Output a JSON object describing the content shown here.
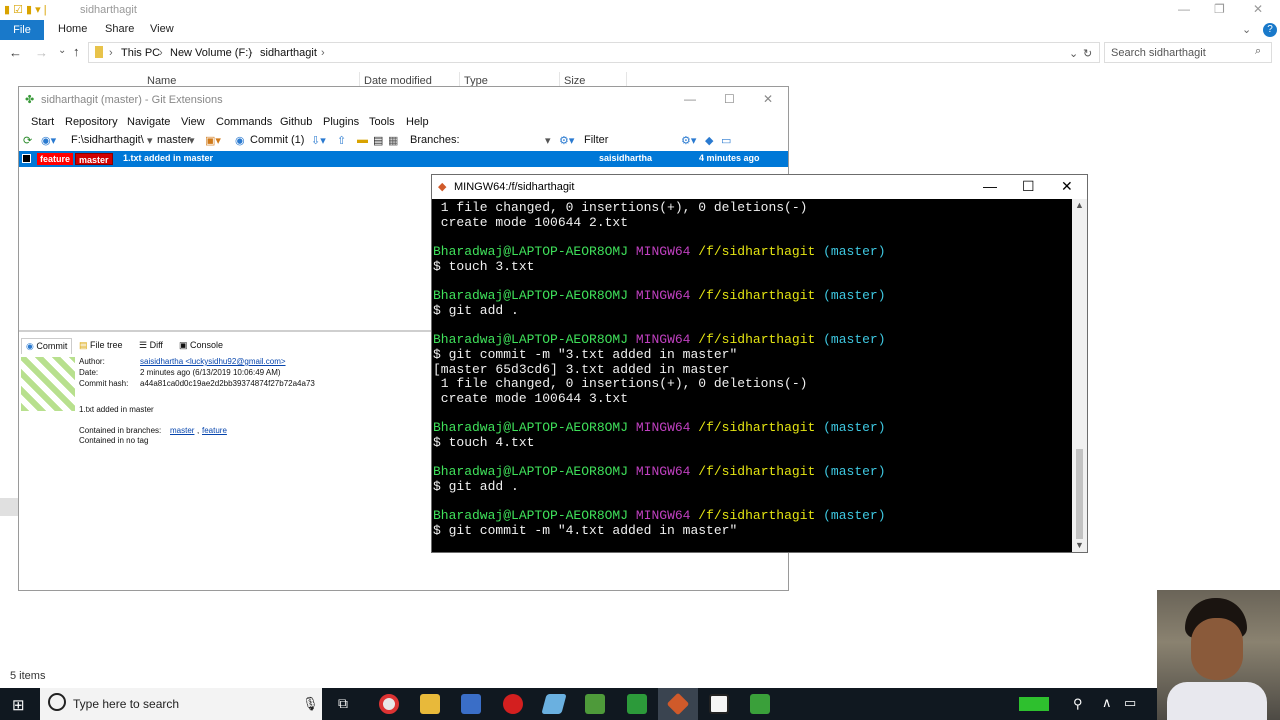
{
  "explorer": {
    "title": "sidharthagit",
    "ribbon": {
      "file": "File",
      "tabs": [
        "Home",
        "Share",
        "View"
      ]
    },
    "address": {
      "crumbs": [
        "This PC",
        "New Volume (F:)",
        "sidharthagit"
      ]
    },
    "search_placeholder": "Search sidharthagit",
    "columns": [
      "Name",
      "Date modified",
      "Type",
      "Size"
    ],
    "status": "5 items"
  },
  "gitext": {
    "title": "sidharthagit (master) - Git Extensions",
    "menu": [
      "Start",
      "Repository",
      "Navigate",
      "View",
      "Commands",
      "Github",
      "Plugins",
      "Tools",
      "Help"
    ],
    "toolbar": {
      "path": "F:\\sidharthagit\\",
      "branch": "master",
      "commit_label": "Commit (1)",
      "branches_label": "Branches:",
      "filter_label": "Filter:"
    },
    "revision": {
      "tags": [
        "feature",
        "master"
      ],
      "message": "1.txt added in master",
      "author": "saisidhartha",
      "when": "4 minutes ago"
    },
    "tabs": [
      "Commit",
      "File tree",
      "Diff",
      "Console"
    ],
    "details": {
      "author_label": "Author:",
      "author_value": "saisidhartha <luckysidhu92@gmail.com>",
      "date_label": "Date:",
      "date_value": "2 minutes ago (6/13/2019 10:06:49 AM)",
      "hash_label": "Commit hash:",
      "hash_value": "a44a81ca0d0c19ae2d2bb39374874f27b72a4a73",
      "message": "1.txt added in master",
      "contained_branches_label": "Contained in branches:",
      "contained_branches": [
        "master",
        "feature"
      ],
      "contained_tags": "Contained in no tag"
    }
  },
  "terminal": {
    "title": "MINGW64:/f/sidharthagit",
    "prompt": {
      "user": "Bharadwaj@LAPTOP-AEOR8OMJ",
      "env": "MINGW64",
      "path": "/f/sidharthagit",
      "branch": "(master)"
    },
    "lines": [
      " 1 file changed, 0 insertions(+), 0 deletions(-)",
      " create mode 100644 2.txt",
      "$ touch 3.txt",
      "$ git add .",
      "$ git commit -m \"3.txt added in master\"",
      "[master 65d3cd6] 3.txt added in master",
      " 1 file changed, 0 insertions(+), 0 deletions(-)",
      " create mode 100644 3.txt",
      "$ touch 4.txt",
      "$ git add .",
      "$ git commit -m \"4.txt added in master\""
    ]
  },
  "taskbar": {
    "search_placeholder": "Type here to search"
  }
}
